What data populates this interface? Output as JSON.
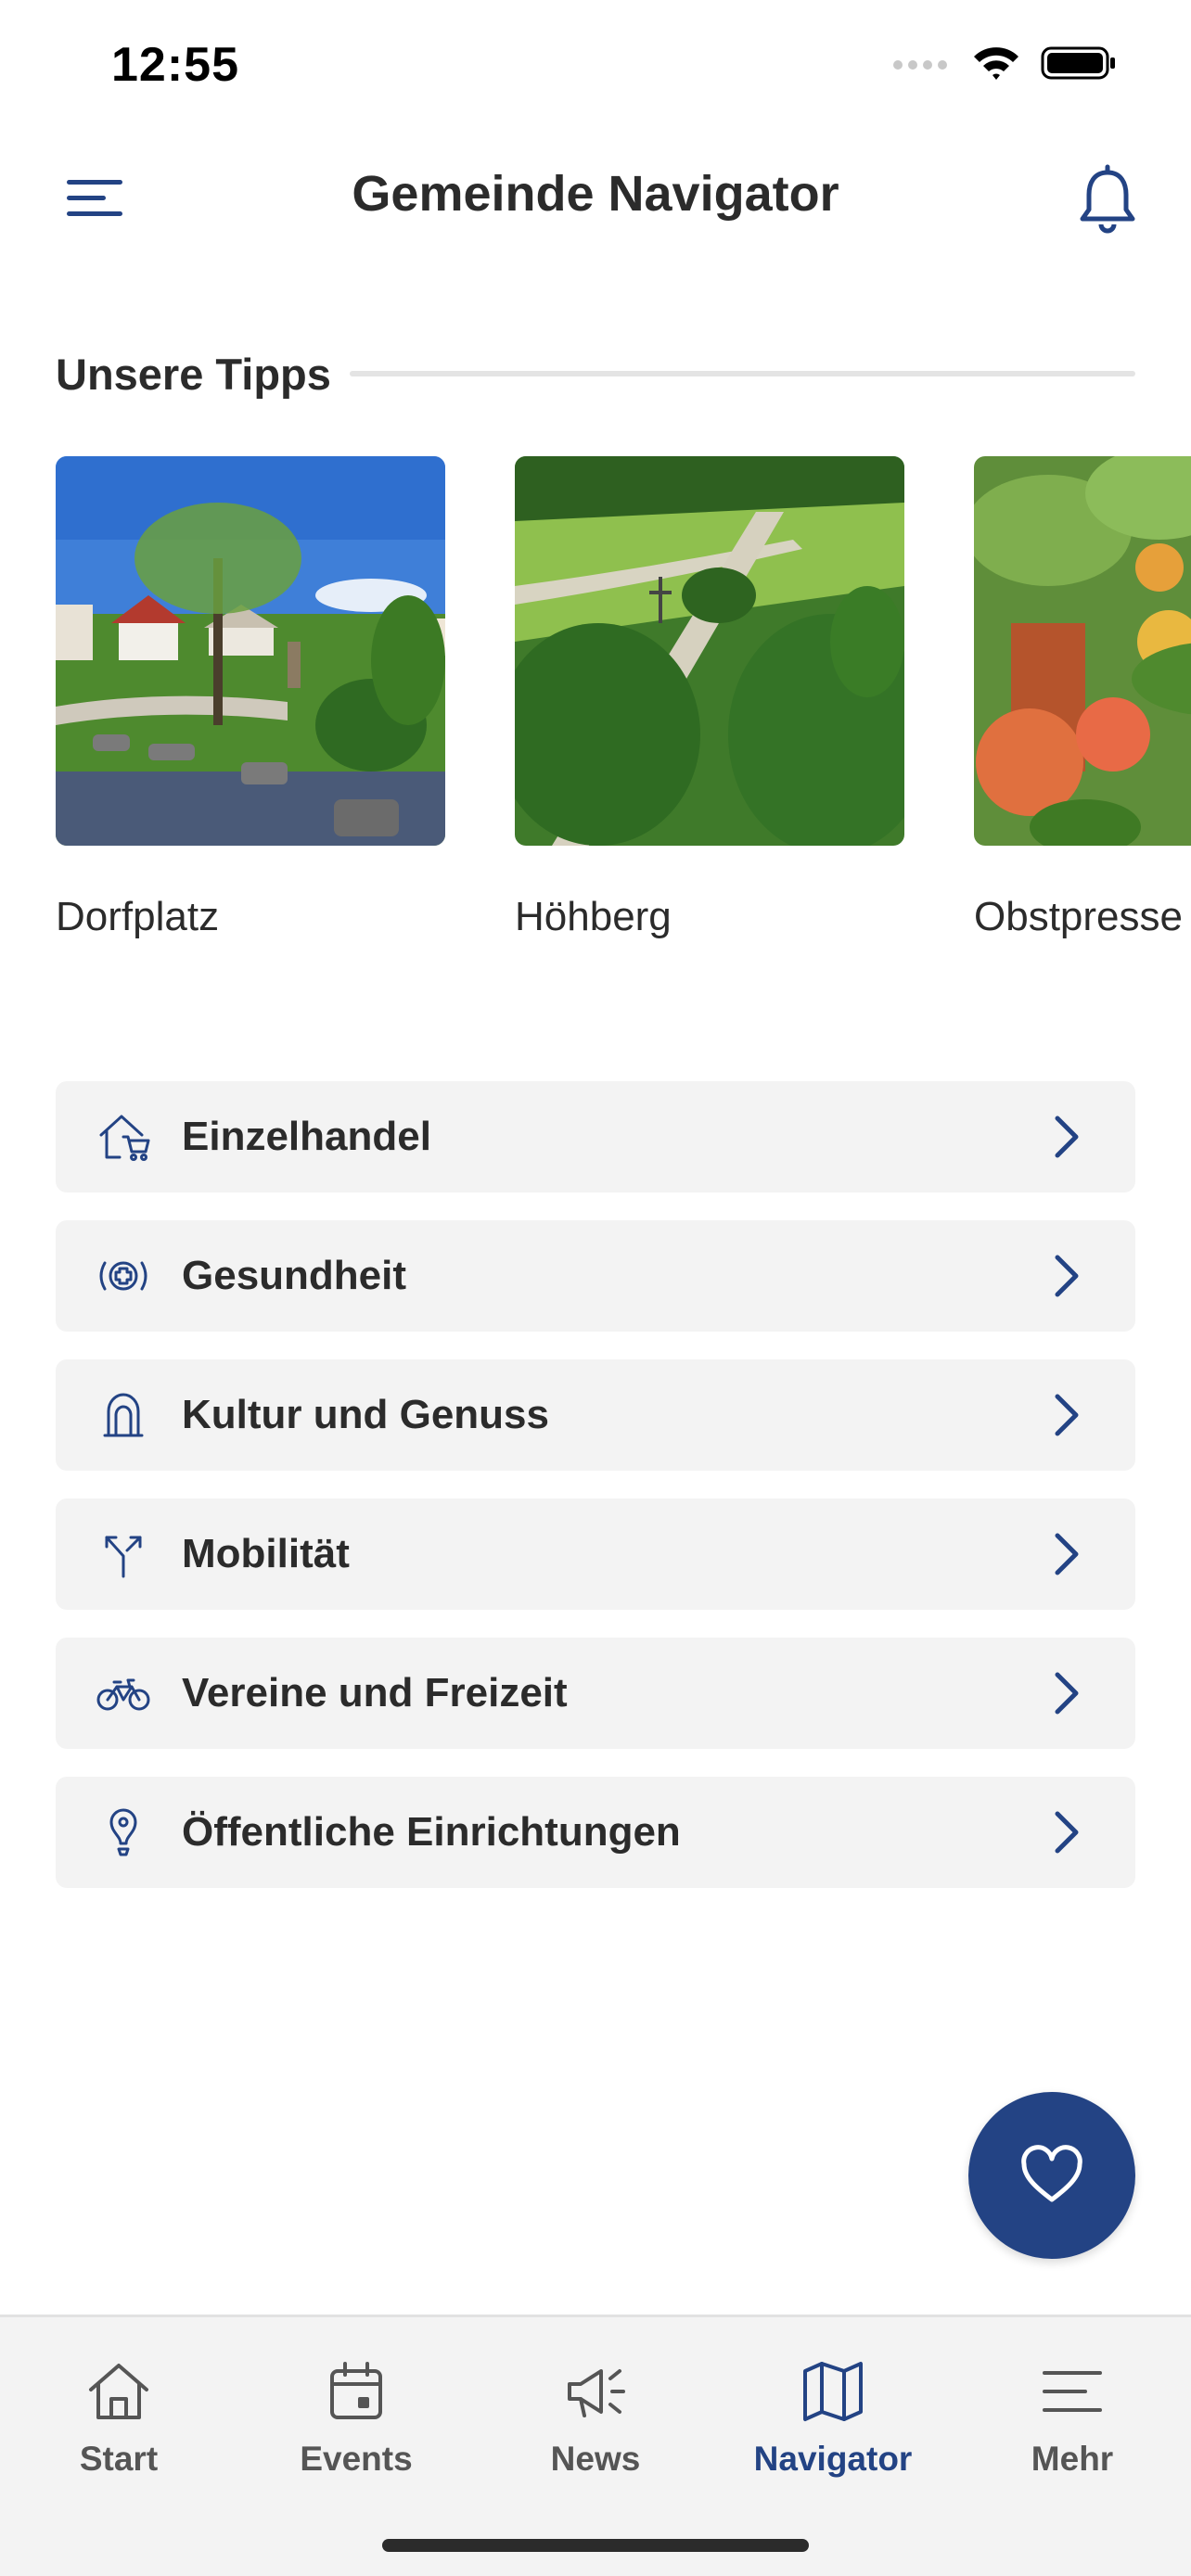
{
  "status_bar": {
    "time": "12:55"
  },
  "header": {
    "title": "Gemeinde Navigator"
  },
  "tips": {
    "title": "Unsere Tipps",
    "items": [
      {
        "label": "Dorfplatz"
      },
      {
        "label": "Höhberg"
      },
      {
        "label": "Obstpresse"
      }
    ]
  },
  "categories": [
    {
      "label": "Einzelhandel",
      "icon": "shop-icon"
    },
    {
      "label": "Gesundheit",
      "icon": "health-icon"
    },
    {
      "label": "Kultur und Genuss",
      "icon": "culture-icon"
    },
    {
      "label": "Mobilität",
      "icon": "directions-icon"
    },
    {
      "label": "Vereine und Freizeit",
      "icon": "bicycle-icon"
    },
    {
      "label": "Öffentliche Einrichtungen",
      "icon": "location-pin-icon"
    }
  ],
  "tab_bar": {
    "active": "Navigator",
    "tabs": [
      {
        "label": "Start",
        "icon": "home-icon"
      },
      {
        "label": "Events",
        "icon": "calendar-icon"
      },
      {
        "label": "News",
        "icon": "megaphone-icon"
      },
      {
        "label": "Navigator",
        "icon": "map-icon"
      },
      {
        "label": "Mehr",
        "icon": "menu-icon"
      }
    ]
  },
  "colors": {
    "accent": "#234384",
    "text": "#2b2b2b",
    "card_bg": "#f3f3f3",
    "tab_inactive": "#555555"
  }
}
